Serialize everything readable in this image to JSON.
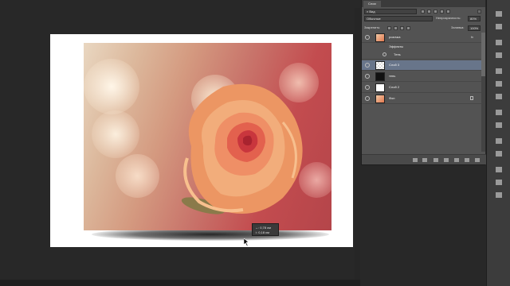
{
  "canvas": {
    "measure_tooltip": {
      "width_line": "↔: 0,78 см",
      "height_line": "↕: 0,18 см"
    }
  },
  "layers_panel": {
    "tab_label": "Слои",
    "filter_label": "Вид",
    "blend_mode": "Обычные",
    "opacity_label": "Непрозрачность:",
    "opacity_value": "80%",
    "lock_label": "Закрепить:",
    "fill_label": "Заливка:",
    "fill_value": "100%",
    "layers": [
      {
        "name": "розочка",
        "fx": "fx",
        "selected": false
      },
      {
        "name": "Эффекты",
        "sub": true
      },
      {
        "name": "Тень",
        "sub": true
      },
      {
        "name": "Слой 3",
        "selected": true
      },
      {
        "name": "тень",
        "selected": false
      },
      {
        "name": "Слой 2",
        "selected": false
      },
      {
        "name": "Фон",
        "selected": false,
        "locked": true
      }
    ],
    "bottom_icons": [
      "link-icon",
      "fx-icon",
      "mask-icon",
      "adjustment-icon",
      "folder-icon",
      "new-layer-icon",
      "trash-icon"
    ]
  },
  "colors": {
    "selection": "#68758a",
    "panel": "#535353",
    "workspace": "#282828"
  }
}
